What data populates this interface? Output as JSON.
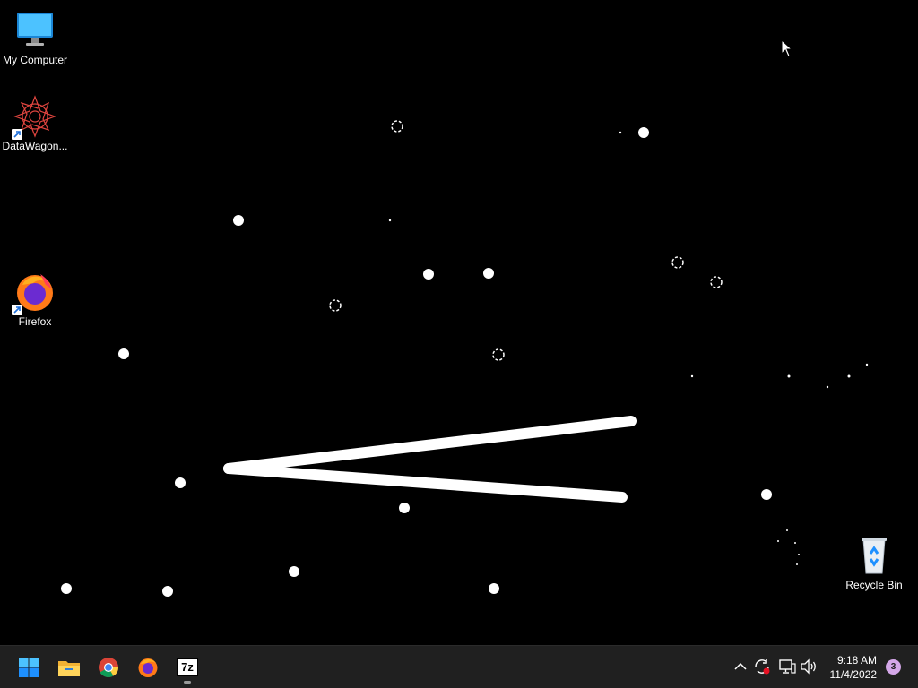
{
  "desktop": {
    "icons": [
      {
        "label": "My Computer",
        "icon": "monitor-icon"
      },
      {
        "label": "DataWagon...",
        "icon": "datawagon-icon"
      },
      {
        "label": "Firefox",
        "icon": "firefox-icon"
      },
      {
        "label": "Recycle Bin",
        "icon": "recycle-bin-icon"
      }
    ],
    "screensaver": "white-dots-and-lines"
  },
  "taskbar": {
    "pinned": [
      {
        "name": "Start",
        "icon": "windows-start-icon"
      },
      {
        "name": "File Explorer",
        "icon": "folder-icon"
      },
      {
        "name": "Google Chrome",
        "icon": "chrome-icon"
      },
      {
        "name": "Firefox",
        "icon": "firefox-icon"
      },
      {
        "name": "7-Zip",
        "icon": "7zip-icon",
        "label": "7z"
      }
    ],
    "tray": {
      "icons": [
        "chevron-up-icon",
        "sync-icon",
        "network-icon",
        "volume-icon"
      ],
      "time": "9:18 AM",
      "date": "11/4/2022",
      "notifications": "3"
    }
  },
  "colors": {
    "taskbar_bg": "#202020",
    "desktop_bg": "#000000",
    "windows_blue": "#1e90ff",
    "badge": "#d4a7e8"
  }
}
